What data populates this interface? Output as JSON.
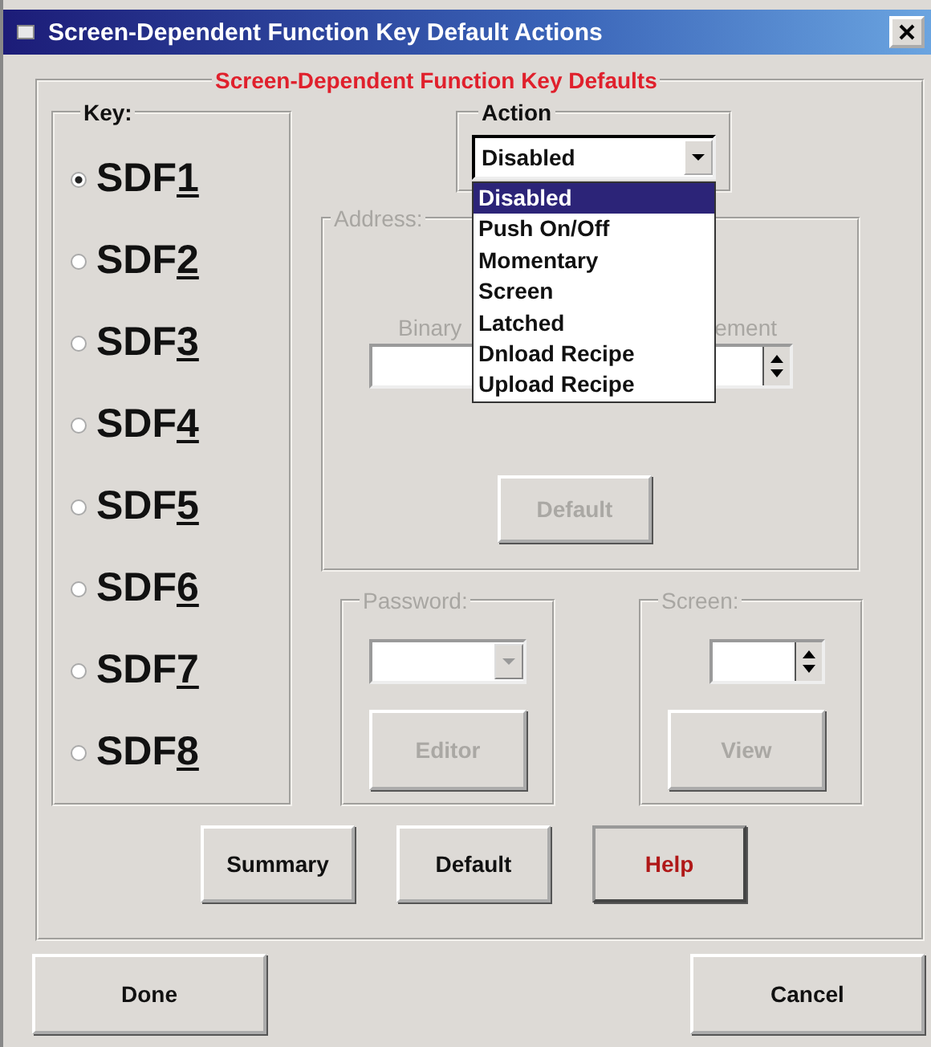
{
  "window": {
    "title": "Screen-Dependent Function Key Default Actions"
  },
  "main_group": {
    "title": "Screen-Dependent Function Key Defaults"
  },
  "key_group": {
    "title": "Key:",
    "options": [
      {
        "label": "SDF1",
        "selected": true
      },
      {
        "label": "SDF2",
        "selected": false
      },
      {
        "label": "SDF3",
        "selected": false
      },
      {
        "label": "SDF4",
        "selected": false
      },
      {
        "label": "SDF5",
        "selected": false
      },
      {
        "label": "SDF6",
        "selected": false
      },
      {
        "label": "SDF7",
        "selected": false
      },
      {
        "label": "SDF8",
        "selected": false
      }
    ]
  },
  "action_group": {
    "title": "Action",
    "value": "Disabled",
    "expanded": true,
    "options": [
      {
        "label": "Disabled",
        "selected": true
      },
      {
        "label": "Push On/Off",
        "selected": false
      },
      {
        "label": "Momentary",
        "selected": false
      },
      {
        "label": "Screen",
        "selected": false
      },
      {
        "label": "Latched",
        "selected": false
      },
      {
        "label": "Dnload Recipe",
        "selected": false
      },
      {
        "label": "Upload Recipe",
        "selected": false
      }
    ]
  },
  "address_group": {
    "title": "Address:",
    "disabled": true,
    "left_label": "Binary",
    "right_label": "ement",
    "default_button": {
      "label": "Default",
      "disabled": true
    }
  },
  "password_group": {
    "title": "Password:",
    "disabled": true,
    "editor_button": {
      "label": "Editor",
      "disabled": true
    }
  },
  "screen_group": {
    "title": "Screen:",
    "disabled": true,
    "view_button": {
      "label": "View",
      "disabled": true
    }
  },
  "buttons": [
    {
      "label": "Summary",
      "kind": "normal"
    },
    {
      "label": "Default",
      "kind": "normal"
    },
    {
      "label": "Help",
      "kind": "help"
    }
  ],
  "footer_buttons": [
    {
      "label": "Done"
    },
    {
      "label": "Cancel"
    }
  ]
}
